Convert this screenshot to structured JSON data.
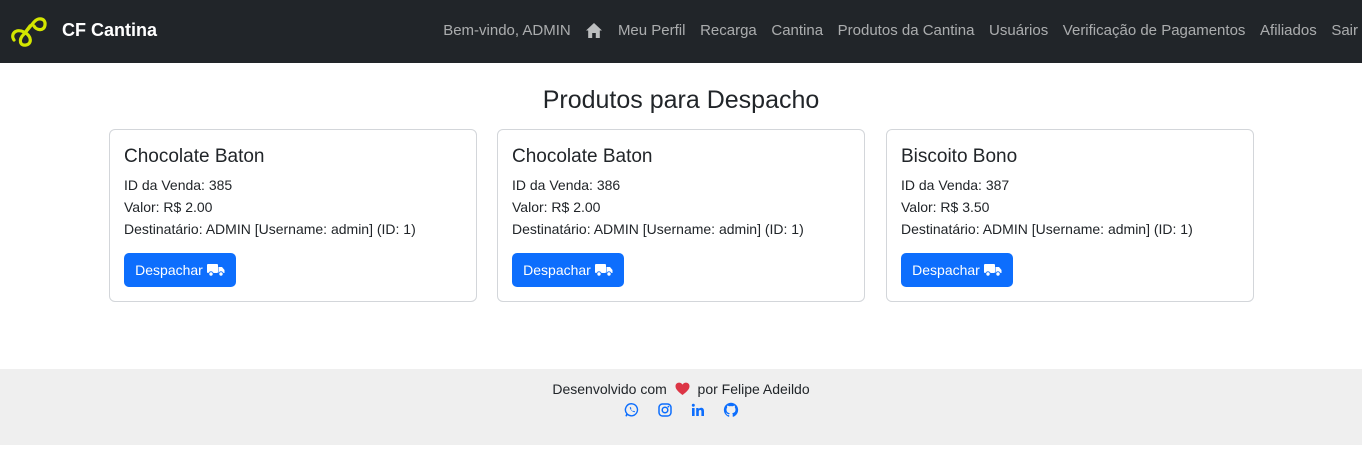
{
  "navbar": {
    "brand": "CF Cantina",
    "links": [
      {
        "label": "Bem-vindo, ADMIN"
      },
      {
        "icon": "home-icon"
      },
      {
        "label": "Meu Perfil"
      },
      {
        "label": "Recarga"
      },
      {
        "label": "Cantina"
      },
      {
        "label": "Produtos da Cantina"
      },
      {
        "label": "Usuários"
      },
      {
        "label": "Verificação de Pagamentos"
      },
      {
        "label": "Afiliados"
      },
      {
        "label": "Sair"
      }
    ]
  },
  "main": {
    "title": "Produtos para Despacho",
    "cards": [
      {
        "title": "Chocolate Baton",
        "sale_id": "ID da Venda: 385",
        "value": "Valor: R$ 2.00",
        "recipient": "Destinatário: ADMIN [Username: admin] (ID: 1)",
        "button": "Despachar"
      },
      {
        "title": "Chocolate Baton",
        "sale_id": "ID da Venda: 386",
        "value": "Valor: R$ 2.00",
        "recipient": "Destinatário: ADMIN [Username: admin] (ID: 1)",
        "button": "Despachar"
      },
      {
        "title": "Biscoito Bono",
        "sale_id": "ID da Venda: 387",
        "value": "Valor: R$ 3.50",
        "recipient": "Destinatário: ADMIN [Username: admin] (ID: 1)",
        "button": "Despachar"
      }
    ]
  },
  "footer": {
    "text_before": "Desenvolvido com",
    "text_after": "por Felipe Adeildo",
    "icons": [
      "whatsapp-icon",
      "instagram-icon",
      "linkedin-icon",
      "github-icon"
    ]
  },
  "colors": {
    "navbar_bg": "#212529",
    "primary": "#0d6efd",
    "footer_bg": "#efefef",
    "heart": "#dc3545",
    "logo": "#d4e600"
  }
}
